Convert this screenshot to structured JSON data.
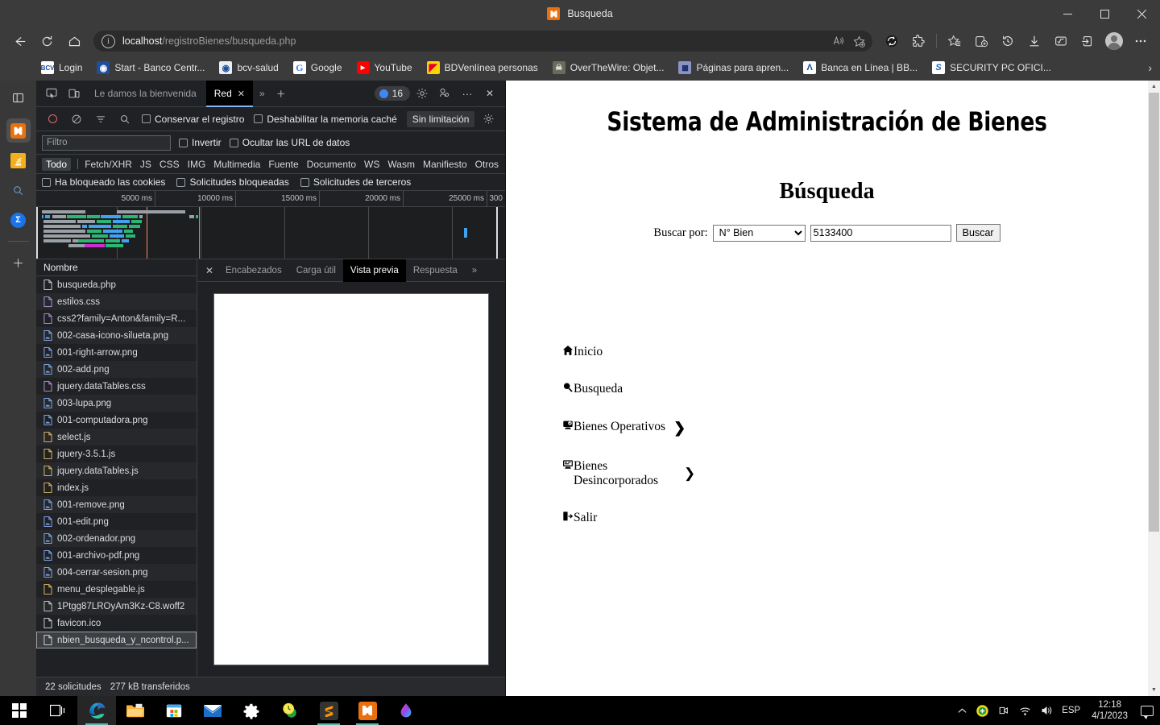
{
  "window": {
    "title": "Busqueda",
    "favicon_glyph": "✖",
    "minimize": "—",
    "maximize": "▢",
    "close": "✕"
  },
  "browser": {
    "back": "←",
    "reload": "↻",
    "home": "⌂",
    "url_prefix": "localhost",
    "url_rest": "/registroBienes/busqueda.php",
    "read_aloud": "read-aloud-icon",
    "add_favorite": "add-favorite-icon",
    "toolbar_icons": [
      "sync-icon",
      "extensions-icon",
      "favorites-icon",
      "collections-icon",
      "history-icon",
      "downloads-icon",
      "math-solver-icon",
      "share-icon",
      "profile-avatar",
      "more-settings-icon"
    ]
  },
  "bookmarks": {
    "overflow": "›",
    "items": [
      {
        "label": "Login",
        "icon_text": "BCV",
        "icon_bg": "#ffffff",
        "icon_fg": "#1a4b9c"
      },
      {
        "label": "Start - Banco Centr...",
        "icon_text": "◉",
        "icon_bg": "#1f4e9c",
        "icon_fg": "#ffffff"
      },
      {
        "label": "bcv-salud",
        "icon_text": "◉",
        "icon_bg": "#e9eef6",
        "icon_fg": "#1f4e9c"
      },
      {
        "label": "Google",
        "icon_text": "G",
        "icon_bg": "#ffffff",
        "icon_fg": "#4285f4"
      },
      {
        "label": "YouTube",
        "icon_text": "▶",
        "icon_bg": "#ff0000",
        "icon_fg": "#ffffff"
      },
      {
        "label": "BDVenlínea personas",
        "icon_text": "◤",
        "icon_bg": "#ffd400",
        "icon_fg": "#e3002b"
      },
      {
        "label": "OverTheWire: Objet...",
        "icon_text": "☠",
        "icon_bg": "#6b6b5a",
        "icon_fg": "#e8e8e8"
      },
      {
        "label": "Páginas para apren...",
        "icon_text": "▩",
        "icon_bg": "#8a93c6",
        "icon_fg": "#1b2a6b"
      },
      {
        "label": "Banca en Línea | BB...",
        "icon_text": "Λ",
        "icon_bg": "#ffffff",
        "icon_fg": "#0a4f9c"
      },
      {
        "label": "SECURITY PC OFICI...",
        "icon_text": "S",
        "icon_bg": "#ffffff",
        "icon_fg": "#1565c0"
      }
    ]
  },
  "vertical_tabs": {
    "panel_toggle": "tab-panel-toggle-icon",
    "items": [
      {
        "name": "xampp-tab",
        "glyph": "✖",
        "bg": "#e8700f",
        "active": true
      },
      {
        "name": "stackoverflow-tab",
        "glyph": "≡",
        "bg": "#f2b01e",
        "active": false
      },
      {
        "name": "search-tabs-icon",
        "glyph": "⌕",
        "bg": "",
        "active": false
      },
      {
        "name": "blue-site-tab",
        "glyph": "Ʃ",
        "bg": "#1a73e8",
        "active": false
      }
    ],
    "add_tab": "+"
  },
  "devtools": {
    "left_icons": [
      "inspect-element-icon",
      "device-toolbar-icon"
    ],
    "tabs": [
      {
        "label": "Le damos la bienvenida",
        "selected": false
      },
      {
        "label": "Red",
        "selected": true,
        "close": "✕"
      }
    ],
    "more_tabs": "»",
    "new_tab": "+",
    "issues_count": "16",
    "settings_icon": "gear-icon",
    "customize_icon": "customize-icon",
    "more_icon": "···",
    "close_icon": "✕",
    "controls": {
      "record": "record-icon",
      "clear": "clear-icon",
      "filter": "filter-icon",
      "search": "search-icon",
      "preserve_log": "Conservar el registro",
      "disable_cache": "Deshabilitar la memoria caché",
      "throttling": "Sin limitación",
      "network_settings": "gear-icon"
    },
    "filter": {
      "placeholder": "Filtro",
      "invert": "Invertir",
      "hide_data_urls": "Ocultar las URL de datos"
    },
    "types": [
      "Todo",
      "Fetch/XHR",
      "JS",
      "CSS",
      "IMG",
      "Multimedia",
      "Fuente",
      "Documento",
      "WS",
      "Wasm",
      "Manifiesto",
      "Otros"
    ],
    "selected_type": "Todo",
    "cookie_filters": [
      "Ha bloqueado las cookies",
      "Solicitudes bloqueadas",
      "Solicitudes de terceros"
    ],
    "overview_ticks": [
      "5000 ms",
      "10000 ms",
      "15000 ms",
      "20000 ms",
      "25000 ms",
      "300"
    ],
    "requests_header": "Nombre",
    "requests": [
      {
        "name": "busqueda.php",
        "type": "doc"
      },
      {
        "name": "estilos.css",
        "type": "css"
      },
      {
        "name": "css2?family=Anton&family=R...",
        "type": "css"
      },
      {
        "name": "002-casa-icono-silueta.png",
        "type": "img"
      },
      {
        "name": "001-right-arrow.png",
        "type": "img"
      },
      {
        "name": "002-add.png",
        "type": "img"
      },
      {
        "name": "jquery.dataTables.css",
        "type": "css"
      },
      {
        "name": "003-lupa.png",
        "type": "img"
      },
      {
        "name": "001-computadora.png",
        "type": "img"
      },
      {
        "name": "select.js",
        "type": "js"
      },
      {
        "name": "jquery-3.5.1.js",
        "type": "js"
      },
      {
        "name": "jquery.dataTables.js",
        "type": "js"
      },
      {
        "name": "index.js",
        "type": "js"
      },
      {
        "name": "001-remove.png",
        "type": "img"
      },
      {
        "name": "001-edit.png",
        "type": "img"
      },
      {
        "name": "002-ordenador.png",
        "type": "img"
      },
      {
        "name": "001-archivo-pdf.png",
        "type": "img"
      },
      {
        "name": "004-cerrar-sesion.png",
        "type": "img"
      },
      {
        "name": "menu_desplegable.js",
        "type": "js"
      },
      {
        "name": "1Ptgg87LROyAm3Kz-C8.woff2",
        "type": "font"
      },
      {
        "name": "favicon.ico",
        "type": "doc"
      },
      {
        "name": "nbien_busqueda_y_ncontrol.p...",
        "type": "doc",
        "selected": true
      }
    ],
    "detail_tabs": [
      "Encabezados",
      "Carga útil",
      "Vista previa",
      "Respuesta"
    ],
    "detail_selected": "Vista previa",
    "detail_close": "✕",
    "detail_more": "»",
    "status": {
      "requests": "22 solicitudes",
      "transferred": "277 kB transferidos"
    }
  },
  "page": {
    "brand_title": "Sistema de Administración de Bienes",
    "section_title": "Búsqueda",
    "search": {
      "label": "Buscar por:",
      "select_value": "N° Bien",
      "select_options": [
        "N° Bien"
      ],
      "input_value": "5133400",
      "button": "Buscar"
    },
    "menu": [
      {
        "label": "Inicio",
        "icon": "home-icon",
        "glyph": "⌂",
        "arrow": ""
      },
      {
        "label": "Busqueda",
        "icon": "magnifier-icon",
        "glyph": "🔍",
        "arrow": ""
      },
      {
        "label": "Bienes Operativos",
        "icon": "computer-icon",
        "glyph": "🖳",
        "arrow": "❯"
      },
      {
        "label": "Bienes Desincorporados",
        "icon": "monitor-icon",
        "glyph": "🖵",
        "arrow": "❯"
      },
      {
        "label": "Salir",
        "icon": "logout-icon",
        "glyph": "⇥",
        "arrow": ""
      }
    ],
    "scrollbar": {
      "up": "▲",
      "down": "▼"
    }
  },
  "taskbar": {
    "items": [
      {
        "name": "start-button",
        "glyph": "⊞"
      },
      {
        "name": "task-view-button",
        "glyph": "❏"
      },
      {
        "name": "edge-taskbar-icon",
        "glyph": "",
        "active": true
      },
      {
        "name": "file-explorer-icon",
        "glyph": "",
        "active": false
      },
      {
        "name": "microsoft-store-icon",
        "glyph": "",
        "active": false
      },
      {
        "name": "mail-icon",
        "glyph": "",
        "active": false
      },
      {
        "name": "settings-icon",
        "glyph": "✿",
        "active": false
      },
      {
        "name": "clock-app-icon",
        "glyph": "",
        "active": false
      },
      {
        "name": "sublime-text-icon",
        "glyph": "S",
        "active": true
      },
      {
        "name": "xampp-icon",
        "glyph": "✖",
        "active": true
      },
      {
        "name": "paint3d-icon",
        "glyph": "",
        "active": false
      }
    ],
    "tray": {
      "show_hidden": "⌃",
      "icons": [
        "antivirus-icon",
        "camera-icon",
        "wifi-icon",
        "volume-icon"
      ],
      "language": "ESP",
      "time": "12:18",
      "date": "4/1/2023",
      "notifications": "notifications-icon"
    }
  }
}
